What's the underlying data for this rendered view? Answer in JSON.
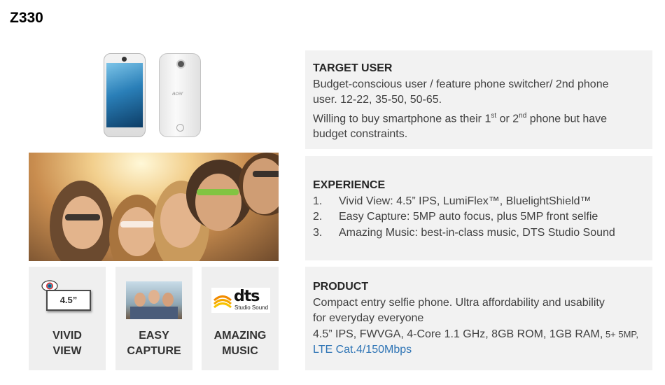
{
  "title": "Z330",
  "phone_brand": "acer",
  "tiles": [
    {
      "line1": "VIVID",
      "line2": "VIEW",
      "badge": "4.5”"
    },
    {
      "line1": "EASY",
      "line2": "CAPTURE"
    },
    {
      "line1": "AMAZING",
      "line2": "MUSIC",
      "logo": "dts",
      "logo_sub": "Studio Sound"
    }
  ],
  "target_user": {
    "heading": "TARGET USER",
    "line1": "Budget-conscious user / feature phone switcher/ 2nd phone",
    "line2": "user. 12-22, 35-50, 50-65.",
    "line3a": "Willing to buy smartphone as their 1",
    "sup1": "st",
    "line3b": " or 2",
    "sup2": "nd",
    "line3c": " phone but have",
    "line4": "budget constraints."
  },
  "experience": {
    "heading": "EXPERIENCE",
    "items": [
      {
        "num": "1.",
        "text": "Vivid View: 4.5” IPS, LumiFlex™, BluelightShield™"
      },
      {
        "num": "2.",
        "text": "Easy Capture: 5MP auto focus, plus 5MP front selfie"
      },
      {
        "num": "3.",
        "text": "Amazing Music: best-in-class music, DTS Studio Sound"
      }
    ]
  },
  "product": {
    "heading": "PRODUCT",
    "line1": "Compact entry selfie phone. Ultra affordability and usability",
    "line2": "for everyday everyone",
    "line3": "4.5” IPS, FWVGA, 4-Core 1.1 GHz, 8GB ROM, 1GB RAM,",
    "line3_small": " 5+ 5MP,",
    "line4": "LTE Cat.4/150Mbps"
  },
  "colors": {
    "panel_bg": "#f2f2f2",
    "link_blue": "#2e74b5"
  }
}
